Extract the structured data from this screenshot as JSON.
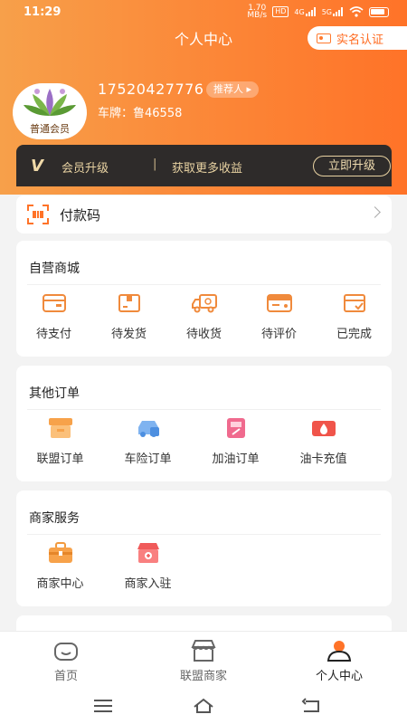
{
  "status_bar": {
    "time": "11:29",
    "speed": "1.70 MB/s",
    "net1": "HD",
    "net2": "4G",
    "net3": "5G"
  },
  "header": {
    "title": "个人中心",
    "realname_label": "实名认证"
  },
  "profile": {
    "phone": "17520427776",
    "referrer_label": "推荐人 ▸",
    "plate": "车牌：鲁46558",
    "member_badge": "普通会员"
  },
  "vip": {
    "logo": "V",
    "label": "会员升级",
    "separator": "|",
    "subtitle": "获取更多收益",
    "button": "立即升级"
  },
  "pay": {
    "label": "付款码"
  },
  "mall": {
    "title": "自营商城",
    "items": [
      {
        "label": "待支付",
        "icon": "wallet-icon"
      },
      {
        "label": "待发货",
        "icon": "package-icon"
      },
      {
        "label": "待收货",
        "icon": "truck-icon"
      },
      {
        "label": "待评价",
        "icon": "review-card-icon"
      },
      {
        "label": "已完成",
        "icon": "completed-box-icon"
      }
    ]
  },
  "other_orders": {
    "title": "其他订单",
    "items": [
      {
        "label": "联盟订单",
        "icon": "alliance-store-icon"
      },
      {
        "label": "车险订单",
        "icon": "car-insurance-icon"
      },
      {
        "label": "加油订单",
        "icon": "fuel-order-icon"
      },
      {
        "label": "油卡充值",
        "icon": "fuel-card-icon"
      }
    ]
  },
  "merchant": {
    "title": "商家服务",
    "items": [
      {
        "label": "商家中心",
        "icon": "briefcase-icon"
      },
      {
        "label": "商家入驻",
        "icon": "shop-join-icon"
      }
    ]
  },
  "bottom_nav": [
    {
      "label": "首页",
      "icon": "home-smile-icon"
    },
    {
      "label": "联盟商家",
      "icon": "storefront-icon"
    },
    {
      "label": "个人中心",
      "icon": "person-icon"
    }
  ],
  "colors": {
    "accent": "#ff7328",
    "vip_bg": "#2e2b2a",
    "vip_text": "#e8d2a2"
  }
}
